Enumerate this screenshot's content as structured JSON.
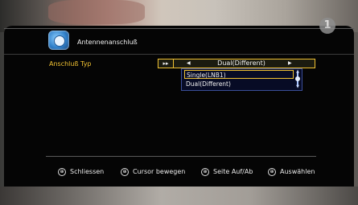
{
  "header": {
    "title": "Antennenanschluß",
    "icon": "satellite-dish-icon",
    "channel_logo": "1"
  },
  "setting": {
    "label": "Anschluß Typ",
    "current_value": "Dual(Different)",
    "options": [
      {
        "label": "Single(LNB1)",
        "highlighted": true
      },
      {
        "label": "Dual(Different)",
        "highlighted": false
      }
    ]
  },
  "footer": {
    "hints": [
      {
        "icon": "exit-button-icon",
        "key": "⊕",
        "label": "Schliessen"
      },
      {
        "icon": "cursor-ok-button-icon",
        "key": "⊕",
        "label": "Cursor bewegen"
      },
      {
        "icon": "page-button-icon",
        "key": "⊕",
        "label": "Seite Auf/Ab"
      },
      {
        "icon": "select-button-icon",
        "key": "⊕",
        "label": "Auswählen"
      }
    ]
  },
  "colors": {
    "highlight": "#f1c232",
    "panel_bg": "#050505",
    "dropdown_bg": "#070b25",
    "text": "#f0f0f0"
  }
}
